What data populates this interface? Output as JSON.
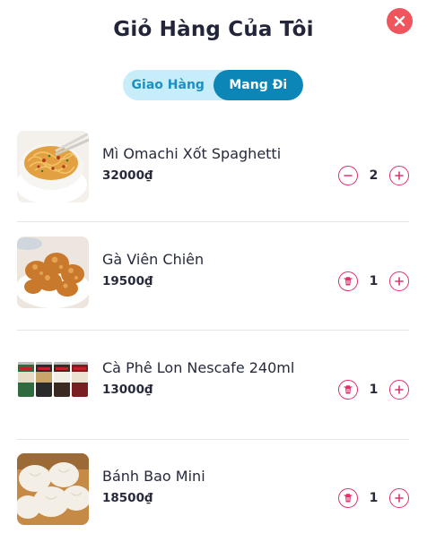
{
  "header": {
    "title": "Giỏ Hàng Của Tôi"
  },
  "mode_toggle": {
    "options": [
      {
        "label": "Giao Hàng",
        "active": false
      },
      {
        "label": "Mang Đi",
        "active": true
      }
    ]
  },
  "colors": {
    "close": "#f0545c",
    "accent": "#e0306e",
    "toggle_active": "#0b86b6",
    "toggle_bg": "#c7ecfa"
  },
  "cart": {
    "items": [
      {
        "name": "Mì Omachi Xốt Spaghetti",
        "price": "32000₫",
        "quantity": "2",
        "decrement_icon": "minus-icon"
      },
      {
        "name": "Gà Viên Chiên",
        "price": "19500₫",
        "quantity": "1",
        "decrement_icon": "trash-icon"
      },
      {
        "name": "Cà Phê Lon Nescafe 240ml",
        "price": "13000₫",
        "quantity": "1",
        "decrement_icon": "trash-icon"
      },
      {
        "name": "Bánh Bao Mini",
        "price": "18500₫",
        "quantity": "1",
        "decrement_icon": "trash-icon"
      }
    ]
  }
}
